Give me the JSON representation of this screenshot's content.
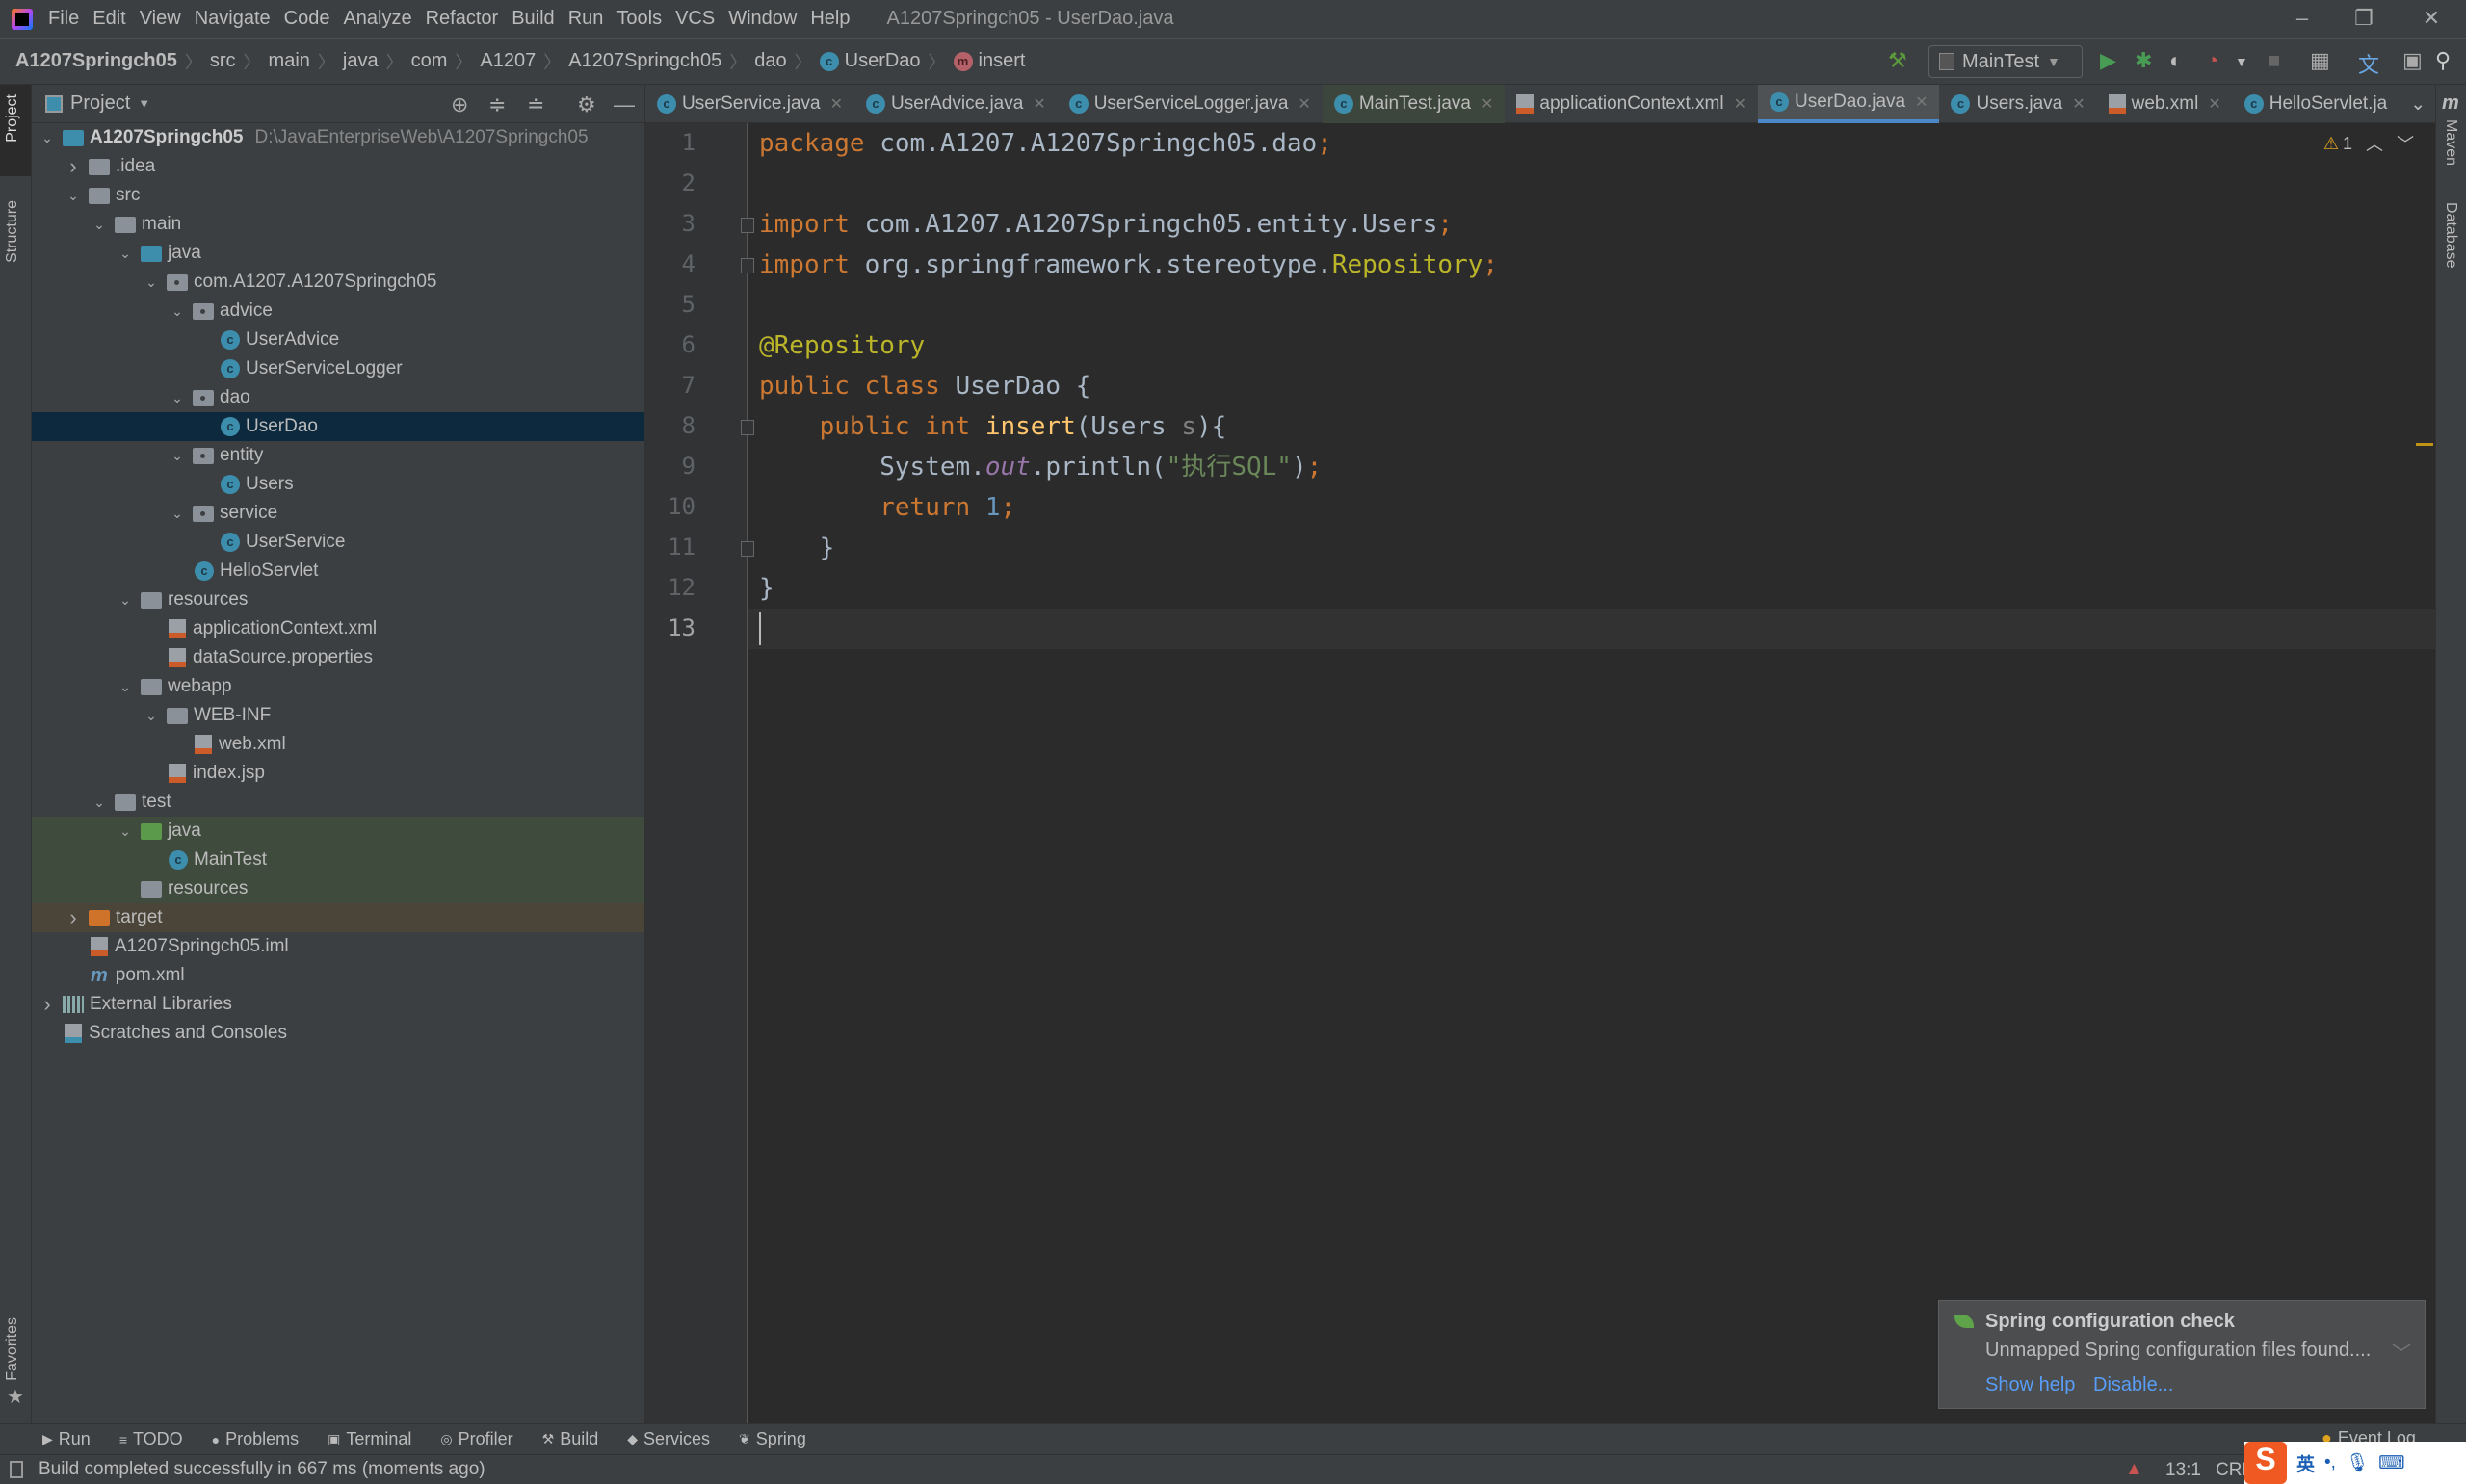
{
  "window": {
    "title": "A1207Springch05 - UserDao.java",
    "minimize": "–",
    "restore": "❐",
    "close": "✕"
  },
  "menu": [
    "File",
    "Edit",
    "View",
    "Navigate",
    "Code",
    "Analyze",
    "Refactor",
    "Build",
    "Run",
    "Tools",
    "VCS",
    "Window",
    "Help"
  ],
  "breadcrumb": [
    "A1207Springch05",
    "src",
    "main",
    "java",
    "com",
    "A1207",
    "A1207Springch05",
    "dao",
    "UserDao",
    "insert"
  ],
  "toolbar": {
    "run_config": "MainTest"
  },
  "left_stripe": {
    "project": "Project",
    "structure": "Structure",
    "favorites": "Favorites"
  },
  "right_stripe": {
    "maven": "Maven",
    "database": "Database"
  },
  "project_panel": {
    "title": "Project",
    "tree": [
      {
        "label": "A1207Springch05",
        "path": "D:\\JavaEnterpriseWeb\\A1207Springch05",
        "depth": 0,
        "arrow": "down",
        "icon": "module",
        "bold": true
      },
      {
        "label": ".idea",
        "depth": 1,
        "arrow": "right",
        "icon": "folder"
      },
      {
        "label": "src",
        "depth": 1,
        "arrow": "down",
        "icon": "folder"
      },
      {
        "label": "main",
        "depth": 2,
        "arrow": "down",
        "icon": "folder"
      },
      {
        "label": "java",
        "depth": 3,
        "arrow": "down",
        "icon": "source-folder"
      },
      {
        "label": "com.A1207.A1207Springch05",
        "depth": 4,
        "arrow": "down",
        "icon": "package"
      },
      {
        "label": "advice",
        "depth": 5,
        "arrow": "down",
        "icon": "package"
      },
      {
        "label": "UserAdvice",
        "depth": 6,
        "icon": "class"
      },
      {
        "label": "UserServiceLogger",
        "depth": 6,
        "icon": "class"
      },
      {
        "label": "dao",
        "depth": 5,
        "arrow": "down",
        "icon": "package"
      },
      {
        "label": "UserDao",
        "depth": 6,
        "icon": "class",
        "state": "selected"
      },
      {
        "label": "entity",
        "depth": 5,
        "arrow": "down",
        "icon": "package"
      },
      {
        "label": "Users",
        "depth": 6,
        "icon": "class"
      },
      {
        "label": "service",
        "depth": 5,
        "arrow": "down",
        "icon": "package"
      },
      {
        "label": "UserService",
        "depth": 6,
        "icon": "class"
      },
      {
        "label": "HelloServlet",
        "depth": 5,
        "icon": "class"
      },
      {
        "label": "resources",
        "depth": 3,
        "arrow": "down",
        "icon": "resources-folder"
      },
      {
        "label": "applicationContext.xml",
        "depth": 4,
        "icon": "xml"
      },
      {
        "label": "dataSource.properties",
        "depth": 4,
        "icon": "properties"
      },
      {
        "label": "webapp",
        "depth": 3,
        "arrow": "down",
        "icon": "web-folder"
      },
      {
        "label": "WEB-INF",
        "depth": 4,
        "arrow": "down",
        "icon": "folder"
      },
      {
        "label": "web.xml",
        "depth": 5,
        "icon": "xml"
      },
      {
        "label": "index.jsp",
        "depth": 4,
        "icon": "jsp"
      },
      {
        "label": "test",
        "depth": 2,
        "arrow": "down",
        "icon": "folder"
      },
      {
        "label": "java",
        "depth": 3,
        "arrow": "down",
        "icon": "test-folder",
        "state": "test"
      },
      {
        "label": "MainTest",
        "depth": 4,
        "icon": "class",
        "state": "test"
      },
      {
        "label": "resources",
        "depth": 3,
        "icon": "resources-folder",
        "state": "test"
      },
      {
        "label": "target",
        "depth": 1,
        "arrow": "right",
        "icon": "excluded-folder",
        "state": "excluded"
      },
      {
        "label": "A1207Springch05.iml",
        "depth": 1,
        "icon": "iml"
      },
      {
        "label": "pom.xml",
        "depth": 1,
        "icon": "maven"
      },
      {
        "label": "External Libraries",
        "depth": 0,
        "arrow": "right",
        "icon": "libraries"
      },
      {
        "label": "Scratches and Consoles",
        "depth": 0,
        "icon": "scratches"
      }
    ]
  },
  "tabs": [
    {
      "label": "UserService.java",
      "icon": "class"
    },
    {
      "label": "UserAdvice.java",
      "icon": "class"
    },
    {
      "label": "UserServiceLogger.java",
      "icon": "class"
    },
    {
      "label": "MainTest.java",
      "icon": "class",
      "state": "test"
    },
    {
      "label": "applicationContext.xml",
      "icon": "xml"
    },
    {
      "label": "UserDao.java",
      "icon": "class",
      "state": "active"
    },
    {
      "label": "Users.java",
      "icon": "class"
    },
    {
      "label": "web.xml",
      "icon": "xml"
    },
    {
      "label": "HelloServlet.ja",
      "icon": "class"
    }
  ],
  "editor": {
    "warnings": "1",
    "current_line": 13,
    "lines": [
      [
        [
          "kw",
          "package "
        ],
        [
          "",
          "com.A1207.A1207Springch05.dao"
        ],
        [
          "kw",
          ";"
        ]
      ],
      [],
      [
        [
          "kw",
          "import "
        ],
        [
          "",
          "com.A1207.A1207Springch05.entity.Users"
        ],
        [
          "kw",
          ";"
        ]
      ],
      [
        [
          "kw",
          "import "
        ],
        [
          "",
          "org.springframework.stereotype."
        ],
        [
          "ann",
          "Repository"
        ],
        [
          "kw",
          ";"
        ]
      ],
      [],
      [
        [
          "ann",
          "@Repository"
        ]
      ],
      [
        [
          "kw",
          "public class "
        ],
        [
          "",
          "UserDao {"
        ]
      ],
      [
        [
          "",
          "    "
        ],
        [
          "kw",
          "public int "
        ],
        [
          "fn",
          "insert"
        ],
        [
          "",
          "(Users "
        ],
        [
          "par",
          "s"
        ],
        [
          "",
          "){"
        ]
      ],
      [
        [
          "",
          "        System."
        ],
        [
          "st",
          "out"
        ],
        [
          "",
          ".println("
        ],
        [
          "str",
          "\"执行SQL\""
        ],
        [
          "",
          ")"
        ],
        [
          "kw",
          ";"
        ]
      ],
      [
        [
          "",
          "        "
        ],
        [
          "kw",
          "return "
        ],
        [
          "num",
          "1"
        ],
        [
          "kw",
          ";"
        ]
      ],
      [
        [
          "",
          "    }"
        ]
      ],
      [
        [
          "",
          "}"
        ]
      ],
      []
    ]
  },
  "notification": {
    "title": "Spring configuration check",
    "body": "Unmapped Spring configuration files found....",
    "actions": [
      "Show help",
      "Disable..."
    ]
  },
  "bottom_tools": [
    "Run",
    "TODO",
    "Problems",
    "Terminal",
    "Profiler",
    "Build",
    "Services",
    "Spring"
  ],
  "event_log": "Event Log",
  "status": {
    "message": "Build completed successfully in 667 ms (moments ago)",
    "position": "13:1",
    "line_sep": "CRLF",
    "ime": "英"
  }
}
